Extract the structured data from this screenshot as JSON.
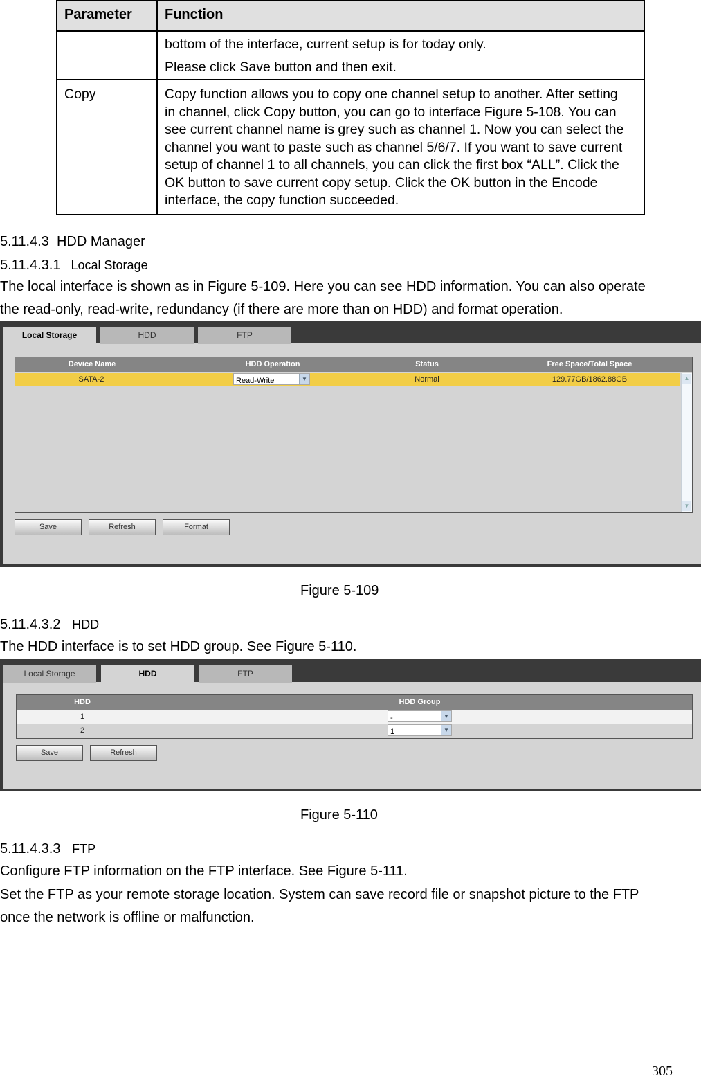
{
  "param_table": {
    "headers": [
      "Parameter",
      "Function"
    ],
    "rows": [
      {
        "parameter": "",
        "function_lines": [
          "bottom of the interface, current setup is for today only.",
          "Please click Save button and then exit."
        ]
      },
      {
        "parameter": "Copy",
        "function": "Copy function allows you to copy one channel setup to another. After setting in channel, click Copy button, you can go to interface Figure 5-108. You can see current channel name is grey such as channel 1. Now you can select the channel you want to paste such as channel 5/6/7. If you want to save current setup of channel 1 to all channels, you can click the first box “ALL”. Click the OK button to save current copy setup. Click the OK button in the Encode interface, the copy function succeeded."
      }
    ]
  },
  "sections": {
    "hdd_manager": {
      "number": "5.11.4.3",
      "title": "HDD Manager"
    },
    "local_storage": {
      "number": "5.11.4.3.1",
      "title": "Local Storage",
      "para_lines": [
        "The local interface is shown as in Figure 5-109. Here you can see HDD information. You can also operate",
        "the read-only, read-write, redundancy (if there are more than on HDD) and format operation."
      ]
    },
    "hdd": {
      "number": "5.11.4.3.2",
      "title": "HDD",
      "para": "The HDD interface is to set HDD group. See Figure 5-110."
    },
    "ftp": {
      "number": "5.11.4.3.3",
      "title": "FTP",
      "para1": "Configure FTP information on the FTP interface. See Figure 5-111.",
      "para2_lines": [
        "Set the FTP as your remote storage location. System can save record file or snapshot picture to the FTP",
        "once the network is offline or malfunction."
      ]
    }
  },
  "figure1": {
    "caption": "Figure 5-109",
    "tabs": [
      "Local Storage",
      "HDD",
      "FTP"
    ],
    "active_tab": "Local Storage",
    "columns": [
      "Device Name",
      "HDD Operation",
      "Status",
      "Free Space/Total Space"
    ],
    "rows": [
      {
        "device_name": "SATA-2",
        "hdd_operation": "Read-Write",
        "status": "Normal",
        "space": "129.77GB/1862.88GB",
        "selected": true
      }
    ],
    "buttons": [
      "Save",
      "Refresh",
      "Format"
    ],
    "highlight_color": "#f2cd46"
  },
  "figure2": {
    "caption": "Figure 5-110",
    "tabs": [
      "Local Storage",
      "HDD",
      "FTP"
    ],
    "active_tab": "HDD",
    "columns": [
      "HDD",
      "HDD Group"
    ],
    "rows": [
      {
        "hdd": "1",
        "group": "-"
      },
      {
        "hdd": "2",
        "group": "1"
      }
    ],
    "buttons": [
      "Save",
      "Refresh"
    ]
  },
  "page_number": "305"
}
